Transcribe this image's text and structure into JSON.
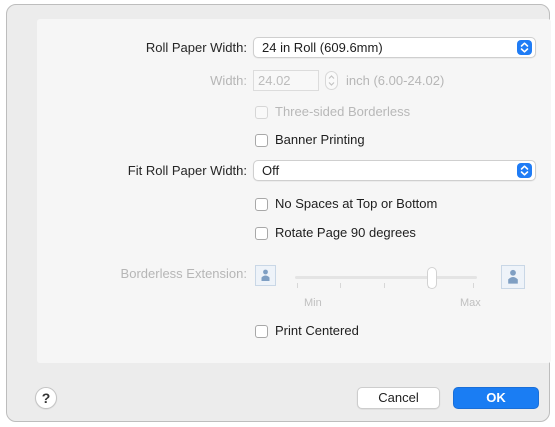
{
  "roll_paper_width": {
    "label": "Roll Paper Width:",
    "value": "24 in Roll (609.6mm)"
  },
  "width": {
    "label": "Width:",
    "value": "24.02",
    "unit_range": "inch (6.00-24.02)"
  },
  "three_sided_borderless": {
    "label": "Three-sided Borderless",
    "checked": false,
    "enabled": false
  },
  "banner_printing": {
    "label": "Banner Printing",
    "checked": false
  },
  "fit_roll_paper_width": {
    "label": "Fit Roll Paper Width:",
    "value": "Off"
  },
  "no_spaces": {
    "label": "No Spaces at Top or Bottom",
    "checked": false
  },
  "rotate_page": {
    "label": "Rotate Page 90 degrees",
    "checked": false
  },
  "borderless_extension": {
    "label": "Borderless Extension:",
    "min_label": "Min",
    "max_label": "Max",
    "level": 0.75,
    "enabled": false
  },
  "print_centered": {
    "label": "Print Centered",
    "checked": false
  },
  "footer": {
    "help": "?",
    "cancel": "Cancel",
    "ok": "OK"
  },
  "colors": {
    "accent": "#1a7df3",
    "disabled_text": "#b6b6b6"
  },
  "icons": {
    "popup": "popup-arrows-icon",
    "stepper": "stepper-arrows-icon",
    "page": "page-person-icon"
  }
}
